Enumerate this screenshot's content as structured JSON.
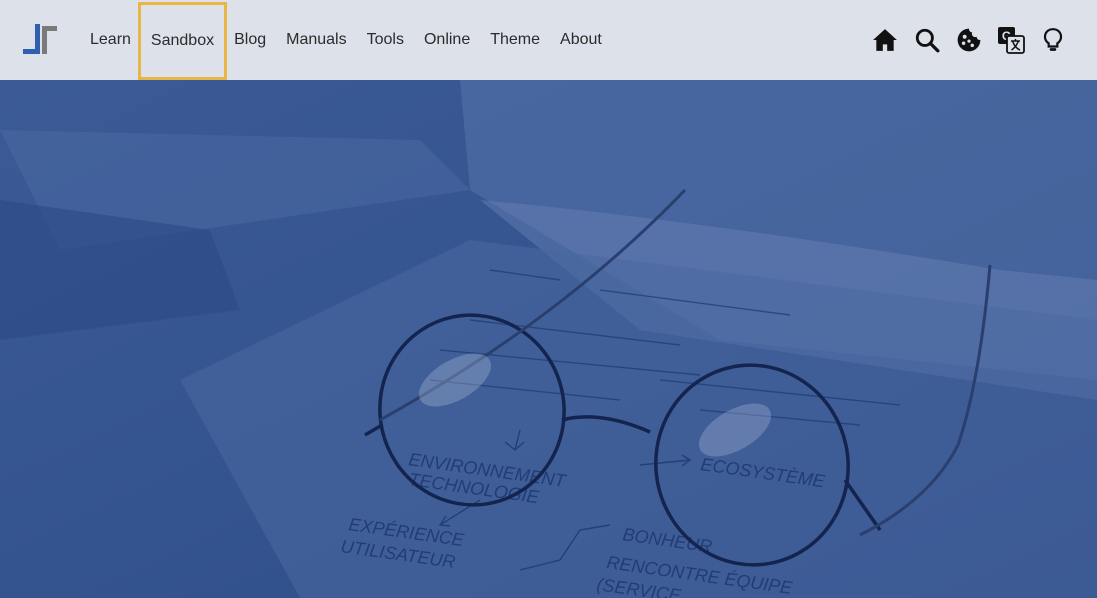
{
  "nav": {
    "logo_icon": "site-logo",
    "links": [
      {
        "label": "Learn"
      },
      {
        "label": "Sandbox"
      },
      {
        "label": "Blog"
      },
      {
        "label": "Manuals"
      },
      {
        "label": "Tools"
      },
      {
        "label": "Online"
      },
      {
        "label": "Theme"
      },
      {
        "label": "About"
      }
    ],
    "highlighted_link": "Sandbox",
    "highlight_color": "#e8b547",
    "icons": [
      "home-icon",
      "search-icon",
      "cookie-icon",
      "translate-icon",
      "lightbulb-icon"
    ]
  },
  "hero": {
    "overlay_color": "#2f4f8c",
    "image_subject": "eyeglasses-on-notebook",
    "handwritten_notes": {
      "left_group": [
        "ENVIRONNEMENT",
        "TECHNOLOGIE"
      ],
      "right_group": [
        "ECOSYSTÈME"
      ],
      "bottom_left": [
        "EXPÉRIENCE",
        "UTILISATEUR"
      ],
      "bottom_right": [
        "BONHEUR",
        "RENCONTRE ÉQUIPE",
        "(SERVICE"
      ]
    }
  },
  "colors": {
    "nav_bg": "#dde1ea",
    "nav_text": "#2b2b2b",
    "logo_blue": "#2f5fae",
    "logo_gray": "#7a7a7a"
  }
}
